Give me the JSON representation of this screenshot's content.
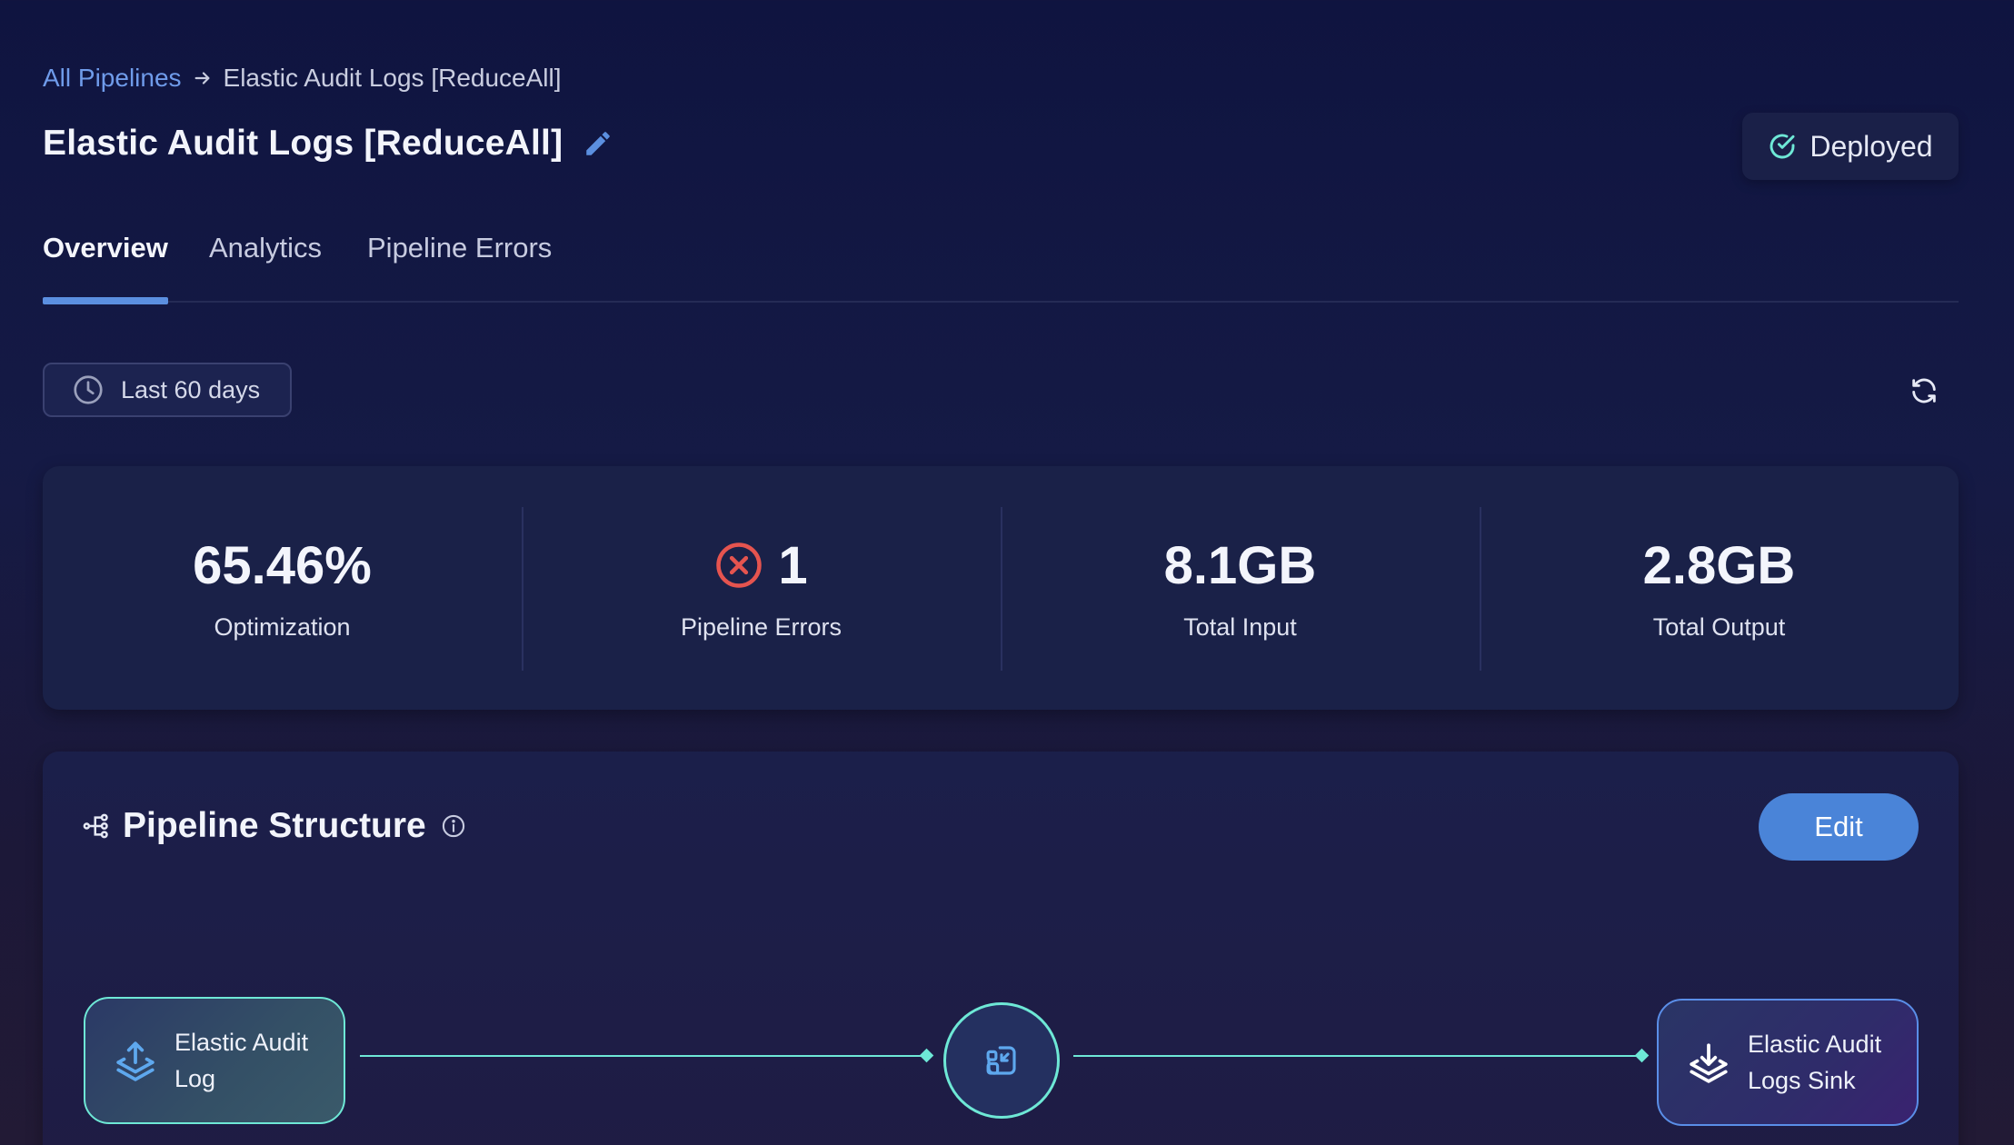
{
  "breadcrumb": {
    "root": "All Pipelines",
    "current": "Elastic Audit Logs [ReduceAll]"
  },
  "header": {
    "title": "Elastic Audit Logs [ReduceAll]",
    "status": "Deployed"
  },
  "tabs": [
    {
      "label": "Overview",
      "active": true
    },
    {
      "label": "Analytics",
      "active": false
    },
    {
      "label": "Pipeline Errors",
      "active": false
    }
  ],
  "filters": {
    "date_range": "Last 60 days"
  },
  "stats": {
    "optimization": {
      "value": "65.46%",
      "label": "Optimization"
    },
    "errors": {
      "value": "1",
      "label": "Pipeline Errors"
    },
    "input": {
      "value": "8.1GB",
      "label": "Total Input"
    },
    "output": {
      "value": "2.8GB",
      "label": "Total Output"
    }
  },
  "structure": {
    "title": "Pipeline Structure",
    "edit_label": "Edit",
    "source": {
      "line1": "Elastic Audit",
      "line2": "Log"
    },
    "sink": {
      "line1": "Elastic Audit",
      "line2": "Logs Sink"
    }
  },
  "colors": {
    "accent": "#5b8fe0",
    "teal": "#6ee8d6",
    "error": "#e5544f",
    "link": "#6f9bea"
  }
}
